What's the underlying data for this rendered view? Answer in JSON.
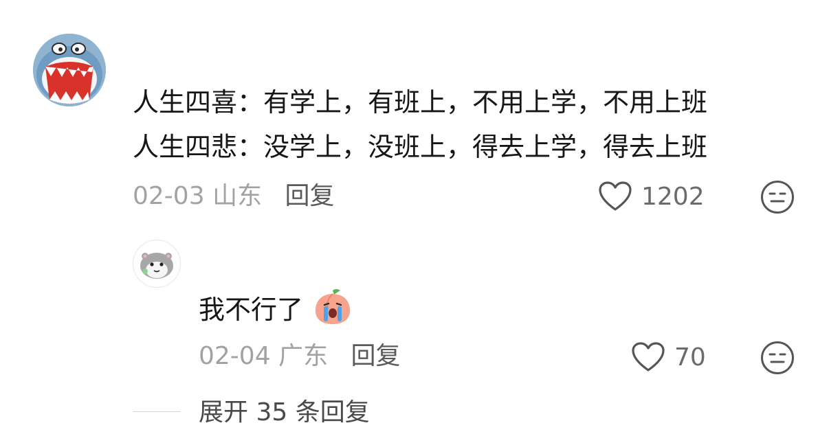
{
  "comment": {
    "line_1": "人生四喜：有学上，有班上，不用上学，不用上班",
    "line_2": "人生四悲：没学上，没班上，得去上学，得去上班",
    "date": "02-03",
    "location": "山东",
    "reply_label": "回复",
    "like_count": "1202"
  },
  "reply": {
    "text": "我不行了",
    "date": "02-04",
    "location": "广东",
    "reply_label": "回复",
    "like_count": "70"
  },
  "expand": {
    "label": "展开 35 条回复"
  },
  "icons": {
    "like": "heart-outline-icon",
    "dislike": "neutral-face-icon",
    "emoji": "crying-peach-emoji"
  }
}
